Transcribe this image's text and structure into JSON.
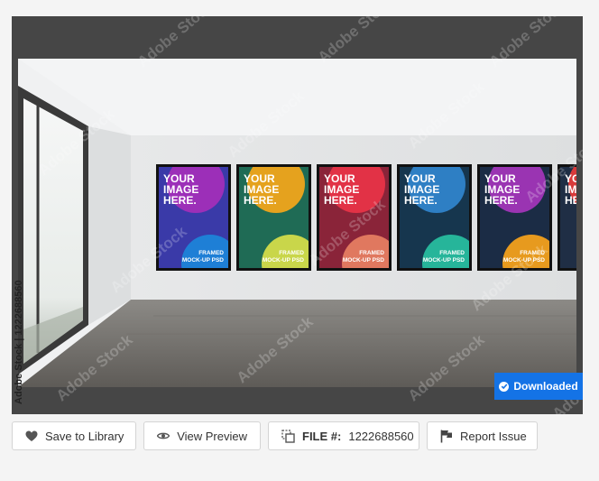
{
  "photo": {
    "poster_headline": [
      "YOUR",
      "IMAGE",
      "HERE."
    ],
    "poster_footer": [
      "FRAMED",
      "MOCK-UP PSD"
    ],
    "posters": [
      {
        "bg": "#3a3aa8",
        "circle_top": "#9c2fb8",
        "circle_bottom": "#1e7fd6"
      },
      {
        "bg": "#1f6b55",
        "circle_top": "#e5a21e",
        "circle_bottom": "#c9d64a"
      },
      {
        "bg": "#8a2439",
        "circle_top": "#e23246",
        "circle_bottom": "#e0785f"
      },
      {
        "bg": "#16364e",
        "circle_top": "#2e7fc4",
        "circle_bottom": "#26b59a"
      },
      {
        "bg": "#1b2c45",
        "circle_top": "#9a34b2",
        "circle_bottom": "#e79a1e"
      },
      {
        "bg": "#1f2e45",
        "circle_top": "#d83a3a",
        "circle_bottom": "#e7a51e"
      }
    ]
  },
  "watermark_text": "Adobe Stock",
  "stock_id_text": "Adobe Stock | 1222688560",
  "badge": {
    "label": "Downloaded",
    "color": "#1473e6"
  },
  "toolbar": {
    "save_label": "Save to Library",
    "preview_label": "View Preview",
    "file_label": "FILE #:",
    "file_number": "1222688560",
    "report_label": "Report Issue"
  }
}
